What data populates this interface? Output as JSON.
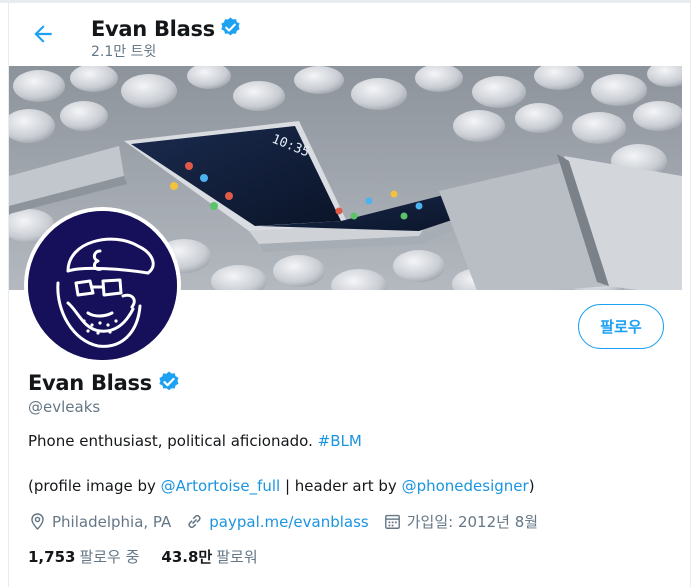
{
  "header": {
    "name": "Evan Blass",
    "tweet_count": "2.1만 트윗"
  },
  "profile": {
    "name": "Evan Blass",
    "handle": "@evleaks",
    "follow_label": "팔로우",
    "bio_text": "Phone enthusiast, political aficionado. ",
    "bio_hashtag": "#BLM",
    "credit_open": "(profile image by ",
    "credit_user1": "@Artortoise_full",
    "credit_middle": " | header art by ",
    "credit_user2": "@phonedesigner",
    "credit_close": ")",
    "location": "Philadelphia, PA",
    "website": "paypal.me/evanblass",
    "joined": "가입일: 2012년 8월"
  },
  "stats": {
    "following_count": "1,753",
    "following_label": "팔로우 중",
    "followers_count": "43.8만",
    "followers_label": "팔로워"
  },
  "banner": {
    "phone_time": "10:35"
  },
  "colors": {
    "accent": "#1da1f2",
    "link": "#1b95e0",
    "muted": "#657786",
    "avatar_bg": "#16105a"
  },
  "icons": {
    "back": "arrow-left-icon",
    "verified": "verified-badge-icon",
    "location": "location-pin-icon",
    "link": "link-icon",
    "calendar": "calendar-icon"
  }
}
